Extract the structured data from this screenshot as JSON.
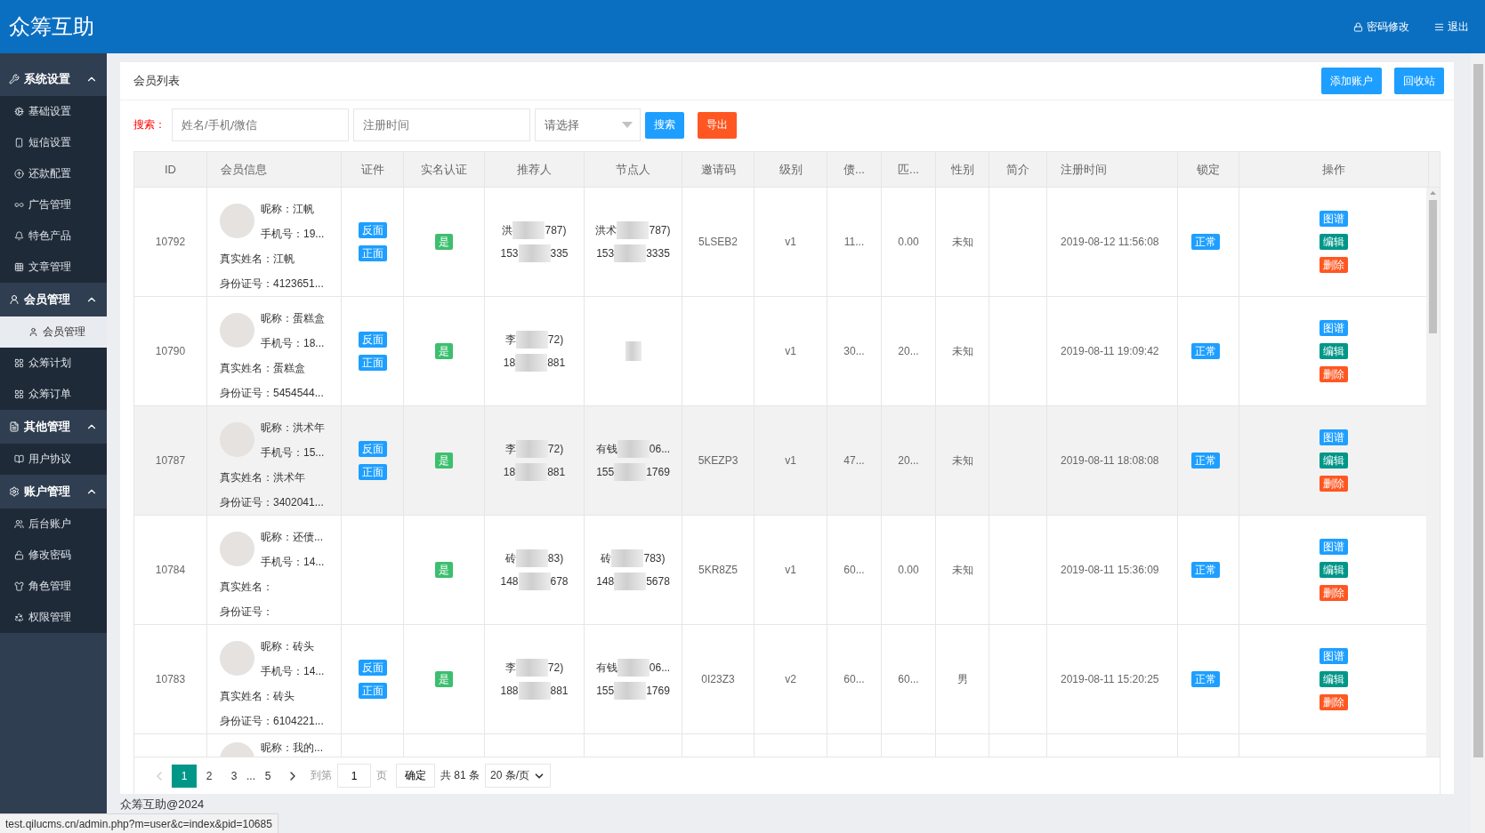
{
  "header": {
    "logo": "众筹互助",
    "links": [
      {
        "label": "密码修改",
        "kind": "lock"
      },
      {
        "label": "退出",
        "kind": "menu"
      }
    ]
  },
  "sidebar": {
    "groups": [
      {
        "title": "系统设置",
        "expanded": true,
        "items": [
          {
            "label": "基础设置",
            "selected": false
          },
          {
            "label": "短信设置",
            "selected": false
          },
          {
            "label": "还款配置",
            "selected": false
          },
          {
            "label": "广告管理",
            "selected": false
          },
          {
            "label": "特色产品",
            "selected": false
          },
          {
            "label": "文章管理",
            "selected": false
          }
        ]
      },
      {
        "title": "会员管理",
        "expanded": true,
        "items": [
          {
            "label": "会员管理",
            "selected": true
          },
          {
            "label": "众筹计划",
            "selected": false
          },
          {
            "label": "众筹订单",
            "selected": false
          }
        ]
      },
      {
        "title": "其他管理",
        "expanded": true,
        "items": [
          {
            "label": "用户协议",
            "selected": false
          }
        ]
      },
      {
        "title": "账户管理",
        "expanded": true,
        "items": [
          {
            "label": "后台账户",
            "selected": false
          },
          {
            "label": "修改密码",
            "selected": false
          },
          {
            "label": "角色管理",
            "selected": false
          },
          {
            "label": "权限管理",
            "selected": false
          }
        ]
      }
    ]
  },
  "card": {
    "title": "会员列表",
    "buttons": [
      "添加账户",
      "回收站"
    ]
  },
  "search": {
    "label": "搜索：",
    "keyword": {
      "placeholder": "姓名/手机/微信"
    },
    "date": {
      "placeholder": "注册时间"
    },
    "select": {
      "placeholder": "请选择"
    },
    "buttons": [
      {
        "label": "搜索",
        "kind": "primary"
      },
      {
        "label": "导出",
        "kind": "danger"
      }
    ]
  },
  "table": {
    "columns": [
      "ID",
      "会员信息",
      "证件",
      "实名认证",
      "推荐人",
      "节点人",
      "邀请码",
      "级别",
      "债...",
      "匹...",
      "性别",
      "简介",
      "注册时间",
      "锁定",
      "操作"
    ],
    "rows": [
      {
        "id": "10792",
        "highlighted": false,
        "info": [
          "昵称：江帆",
          "手机号：19...",
          "真实姓名：江帆",
          "身份证号：4123651..."
        ],
        "documents": [
          "反面",
          "正面"
        ],
        "verified": "是",
        "referrer": [
          {
            "before": "洪",
            "after": "787)"
          },
          {
            "before": "153",
            "after": "335"
          }
        ],
        "node": [
          {
            "before": "洪术",
            "after": "787)"
          },
          {
            "before": "153",
            "after": "3335"
          }
        ],
        "invite_code": "5LSEB2",
        "level": "v1",
        "column_9": "11...",
        "column_10": "0.00",
        "gender": "未知",
        "reg_time": "2019-08-12 11:56:08",
        "lock": "正常",
        "actions": [
          {
            "label": "图谱",
            "kind": "graph"
          },
          {
            "label": "编辑",
            "kind": "edit"
          },
          {
            "label": "删除",
            "kind": "delete"
          }
        ]
      },
      {
        "id": "10790",
        "highlighted": false,
        "info": [
          "昵称：蛋糕盒",
          "手机号：18...",
          "真实姓名：蛋糕盒",
          "身份证号：5454544..."
        ],
        "documents": [
          "反面",
          "正面"
        ],
        "verified": "是",
        "referrer": [
          {
            "before": "李",
            "after": "72)"
          },
          {
            "before": "18",
            "after": "881"
          }
        ],
        "node": [],
        "level": "v1",
        "column_9": "30...",
        "column_10": "20...",
        "gender": "未知",
        "reg_time": "2019-08-11 19:09:42",
        "lock": "正常",
        "actions": [
          {
            "label": "图谱",
            "kind": "graph"
          },
          {
            "label": "编辑",
            "kind": "edit"
          },
          {
            "label": "删除",
            "kind": "delete"
          }
        ]
      },
      {
        "id": "10787",
        "highlighted": true,
        "info": [
          "昵称：洪术年",
          "手机号：15...",
          "真实姓名：洪术年",
          "身份证号：3402041..."
        ],
        "documents": [
          "反面",
          "正面"
        ],
        "verified": "是",
        "referrer": [
          {
            "before": "李",
            "after": "72)"
          },
          {
            "before": "18",
            "after": "881"
          }
        ],
        "node": [
          {
            "before": "有钱",
            "after": "06..."
          },
          {
            "before": "155",
            "after": "1769"
          }
        ],
        "invite_code": "5KEZP3",
        "level": "v1",
        "column_9": "47...",
        "column_10": "20...",
        "gender": "未知",
        "reg_time": "2019-08-11 18:08:08",
        "lock": "正常",
        "actions": [
          {
            "label": "图谱",
            "kind": "graph"
          },
          {
            "label": "编辑",
            "kind": "edit"
          },
          {
            "label": "删除",
            "kind": "delete"
          }
        ]
      },
      {
        "id": "10784",
        "highlighted": false,
        "info": [
          "昵称：还债...",
          "手机号：14...",
          "真实姓名：",
          "身份证号："
        ],
        "documents": [],
        "verified": "是",
        "referrer": [
          {
            "before": "砖",
            "after": "83)"
          },
          {
            "before": "148",
            "after": "678"
          }
        ],
        "node": [
          {
            "before": "砖",
            "after": "783)"
          },
          {
            "before": "148",
            "after": "5678"
          }
        ],
        "invite_code": "5KR8Z5",
        "level": "v1",
        "column_9": "60...",
        "column_10": "0.00",
        "gender": "未知",
        "reg_time": "2019-08-11 15:36:09",
        "lock": "正常",
        "actions": [
          {
            "label": "图谱",
            "kind": "graph"
          },
          {
            "label": "编辑",
            "kind": "edit"
          },
          {
            "label": "删除",
            "kind": "delete"
          }
        ]
      },
      {
        "id": "10783",
        "highlighted": false,
        "info": [
          "昵称：砖头",
          "手机号：14...",
          "真实姓名：砖头",
          "身份证号：6104221..."
        ],
        "documents": [
          "反面",
          "正面"
        ],
        "verified": "是",
        "referrer": [
          {
            "before": "李",
            "after": "72)"
          },
          {
            "before": "188",
            "after": "881"
          }
        ],
        "node": [
          {
            "before": "有钱",
            "after": "06..."
          },
          {
            "before": "155",
            "after": "1769"
          }
        ],
        "invite_code": "0I23Z3",
        "level": "v2",
        "column_9": "60...",
        "column_10": "60...",
        "gender": "男",
        "reg_time": "2019-08-11 15:20:25",
        "lock": "正常",
        "actions": [
          {
            "label": "图谱",
            "kind": "graph"
          },
          {
            "label": "编辑",
            "kind": "edit"
          },
          {
            "label": "删除",
            "kind": "delete"
          }
        ]
      },
      {
        "highlighted": false,
        "info": [
          "昵称：我的..."
        ]
      }
    ]
  },
  "pagination": {
    "pages": [
      {
        "label": "1",
        "selected": true,
        "kind": "page"
      },
      {
        "label": "2",
        "selected": false,
        "kind": "page"
      },
      {
        "label": "3",
        "selected": false,
        "kind": "page"
      },
      {
        "label": "...",
        "kind": "ellipsis"
      },
      {
        "label": "5",
        "selected": false,
        "kind": "page"
      }
    ],
    "goto_label": "到第",
    "goto_value": "1",
    "page_unit": "页",
    "confirm": "确定",
    "total": "共 81 条",
    "page_size": "20 条/页"
  },
  "footer": "众筹互助@2024",
  "status_url": "test.qilucms.cn/admin.php?m=user&c=index&pid=10685"
}
